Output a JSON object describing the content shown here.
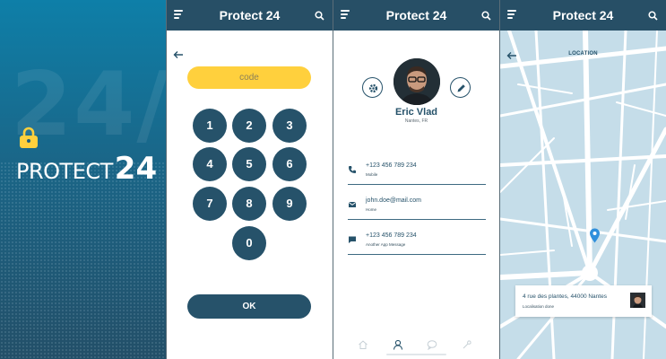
{
  "colors": {
    "navy": "#26526a",
    "appbar": "#274f66",
    "accent_yellow": "#ffd03d",
    "map_block": "#c5dde9",
    "pin": "#2f8fdc"
  },
  "splash": {
    "bg_text": "24/7",
    "brand_word": "PROTECT",
    "brand_number": "24",
    "icon": "lock-icon"
  },
  "appbar": {
    "title": "Protect 24",
    "menu_icon": "menu-icon",
    "search_icon": "search-icon"
  },
  "codepad": {
    "placeholder": "code",
    "keys": [
      "1",
      "2",
      "3",
      "4",
      "5",
      "6",
      "7",
      "8",
      "9",
      "0"
    ],
    "ok_label": "OK",
    "back_icon": "arrow-left-icon"
  },
  "profile": {
    "name": "Eric Vlad",
    "location": "Nantes, FR",
    "settings_icon": "gear-icon",
    "edit_icon": "pencil-icon",
    "contacts": [
      {
        "value": "+123 456 789 234",
        "label": "Mobile",
        "icon": "phone-icon"
      },
      {
        "value": "john.doe@mail.com",
        "label": "Home",
        "icon": "mail-icon"
      },
      {
        "value": "+123 456 789 234",
        "label": "Another App Message",
        "icon": "chat-icon"
      }
    ],
    "tabs": [
      "home-icon",
      "user-icon",
      "chat-bubble-icon",
      "tools-icon"
    ]
  },
  "location": {
    "title": "LOCATION",
    "address": "4 rue des plantes, 44000 Nantes",
    "status": "Localisation done",
    "back_icon": "arrow-left-icon",
    "pin_icon": "map-pin-icon"
  }
}
